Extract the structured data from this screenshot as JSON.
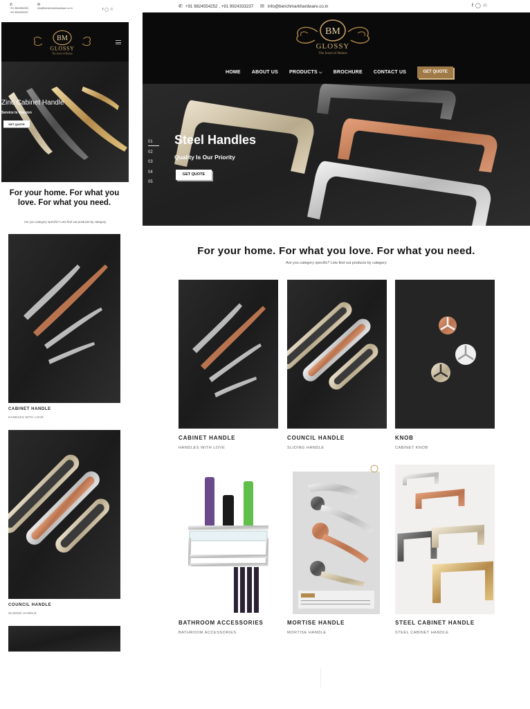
{
  "brand": {
    "monogram": "BM",
    "name": "GLOSSY",
    "tagline": "The Jewel of Homes"
  },
  "contact": {
    "phone": "+91 9824554252 , +91 9924333237",
    "email": "info@benchmarkhardware.co.in",
    "mobile_phone_line1": "+91 9824554252 ,",
    "mobile_phone_line2": "+91 9924333237"
  },
  "social": [
    "facebook-icon",
    "instagram-icon",
    "pinterest-icon"
  ],
  "nav": {
    "home": "HOME",
    "about": "ABOUT US",
    "products": "PRODUCTS",
    "brochure": "BROCHURE",
    "contact": "CONTACT US",
    "quote": "GET QUOTE"
  },
  "desktop_hero": {
    "title": "Steel Handles",
    "subtitle": "Quality Is Our Priority",
    "button": "GET QUOTE",
    "slides": [
      "01",
      "02",
      "03",
      "04",
      "05"
    ]
  },
  "mobile_hero": {
    "title": "Zinc Cabinet Handle",
    "subtitle": "Service Is Passion",
    "button": "GET QUOTE"
  },
  "section": {
    "tagline": "For your home. For what you love. For what you need.",
    "subtagline": "Are you category specific? Lets find out products by category"
  },
  "mobile_section": {
    "tagline": "For your home. For what you love. For what you need."
  },
  "categories": [
    {
      "title": "CABINET HANDLE",
      "subtitle": "HANDLES WITH LOVE"
    },
    {
      "title": "COUNCIL HANDLE",
      "subtitle": "SLIDING HANDLE"
    },
    {
      "title": "KNOB",
      "subtitle": "CABINET KNOB"
    },
    {
      "title": "BATHROOM ACCESSORIES",
      "subtitle": "BATHROOM ACCESSORIES"
    },
    {
      "title": "MORTISE HANDLE",
      "subtitle": "MORTISE HANDLE"
    },
    {
      "title": "STEEL CABINET HANDLE",
      "subtitle": "STEEL CABINET HANDLE"
    }
  ],
  "colors": {
    "gold": "#a07a46",
    "dark": "#0a0a0a",
    "copper": "#b8734e"
  }
}
